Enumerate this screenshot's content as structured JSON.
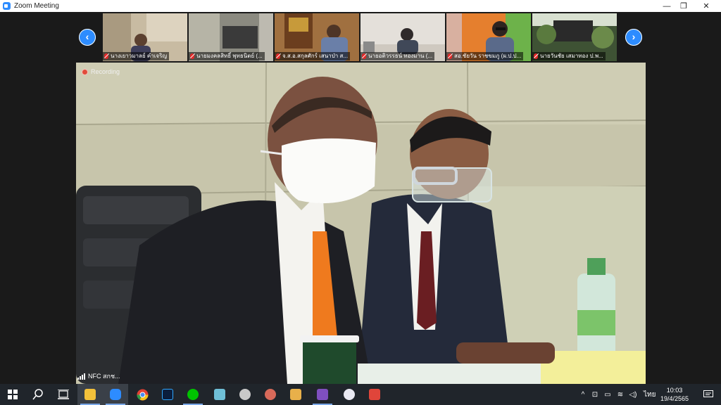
{
  "window": {
    "title": "Zoom Meeting",
    "minimize_glyph": "—",
    "restore_glyph": "❐",
    "close_glyph": "✕"
  },
  "gallery": {
    "prev_glyph": "‹",
    "next_glyph": "›",
    "participants": [
      {
        "name": "นางเยาวมาลย์ คำเจริญ",
        "bg": "#b5a78f"
      },
      {
        "name": "นายมงคลสิทธิ์ พุทธนิตย์ (...",
        "bg": "#7a7a72"
      },
      {
        "name": "จ.ส.อ.สกุลศักร์ เสนาป่า ส...",
        "bg": "#8a5a32"
      },
      {
        "name": "นายอติวรรธน์ ทองมาน (...",
        "bg": "#d9d4cc"
      },
      {
        "name": "สอ.ชัยวัน ราชขมภู (ผ.ป.ป...",
        "bg": "#e07a2a"
      },
      {
        "name": "นายวันชัย เสมาทอง ป.พ...",
        "bg": "#4a5e3a"
      }
    ]
  },
  "main_video": {
    "recording_label": "Recording",
    "speaker_label": "NFC สกช..."
  },
  "taskbar": {
    "apps": [
      {
        "name": "windows-start-icon",
        "color": "#ffffff"
      },
      {
        "name": "search-icon",
        "color": "#ffffff"
      },
      {
        "name": "task-view-icon",
        "color": "#ffffff"
      },
      {
        "name": "file-explorer-icon",
        "color": "#f3c13a"
      },
      {
        "name": "zoom-app-icon",
        "color": "#2d8cff"
      },
      {
        "name": "chrome-icon",
        "color": "#e34133"
      },
      {
        "name": "photoshop-icon",
        "color": "#0b1e3d"
      },
      {
        "name": "line-app-icon",
        "color": "#00c300"
      },
      {
        "name": "notes-app-icon",
        "color": "#6fbfd7"
      },
      {
        "name": "messenger-app-icon",
        "color": "#c9c9c9"
      },
      {
        "name": "map-app-icon",
        "color": "#d86a5a"
      },
      {
        "name": "document-app-icon",
        "color": "#e8b04a"
      },
      {
        "name": "visual-studio-icon",
        "color": "#7f4fbf"
      },
      {
        "name": "itunes-icon",
        "color": "#e9e9f2"
      },
      {
        "name": "anydesk-icon",
        "color": "#e0453a"
      }
    ],
    "language": "ไทย",
    "time": "10:03",
    "date": "19/4/2565"
  }
}
